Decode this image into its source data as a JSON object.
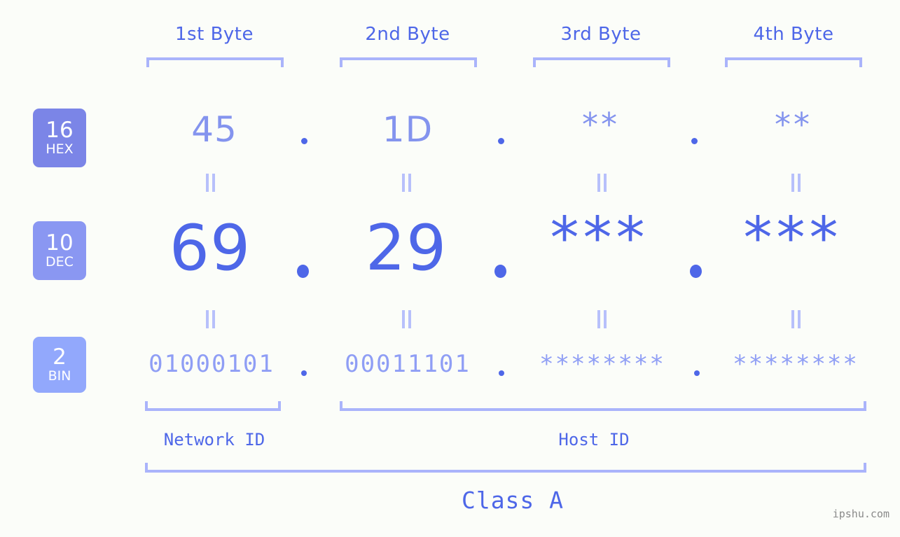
{
  "meta": {
    "watermark": "ipshu.com",
    "background_color": "#fbfdf9",
    "accent_color": "#4e67e8",
    "accent_light_color": "#8494ee",
    "bracket_color": "#aab4fb"
  },
  "columns": [
    {
      "header": "1st Byte"
    },
    {
      "header": "2nd Byte"
    },
    {
      "header": "3rd Byte"
    },
    {
      "header": "4th Byte"
    }
  ],
  "rows": [
    {
      "radix": "16",
      "radix_label": "HEX",
      "badge_color": "#7b85e7",
      "values": [
        "45",
        "1D",
        "**",
        "**"
      ],
      "separator": "."
    },
    {
      "radix": "10",
      "radix_label": "DEC",
      "badge_color": "#8a97f2",
      "values": [
        "69",
        "29",
        "***",
        "***"
      ],
      "separator": "."
    },
    {
      "radix": "2",
      "radix_label": "BIN",
      "badge_color": "#92a8fc",
      "values": [
        "01000101",
        "00011101",
        "********",
        "********"
      ],
      "separator": "."
    }
  ],
  "equals_marker": "||",
  "id_sections": {
    "network": "Network ID",
    "host": "Host ID"
  },
  "class_label": "Class A"
}
